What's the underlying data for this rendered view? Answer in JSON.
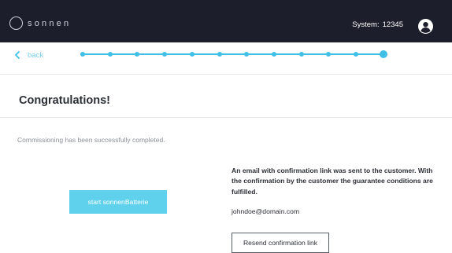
{
  "header": {
    "logo_text": "sonnen",
    "system_label": "System:",
    "system_id": "12345",
    "user_icon": "user-circle-icon"
  },
  "nav": {
    "back_label": "back",
    "back_icon": "chevron-left-icon",
    "steps_total": 12,
    "steps_current": 12,
    "accent_color": "#40bfe6"
  },
  "main": {
    "title": "Congratulations!",
    "status_text": "Commissioning has been successfully completed.",
    "start_button_label": "start sonnenBatterie",
    "info_text": "An email with confirmation link was sent to the customer. With the confirmation by the customer the guarantee conditions are fulfilled.",
    "email": "johndoe@domain.com",
    "resend_button_label": "Resend confirmation link"
  },
  "colors": {
    "header_bg": "#1c1f2b",
    "button_primary": "#5fd1ec"
  }
}
